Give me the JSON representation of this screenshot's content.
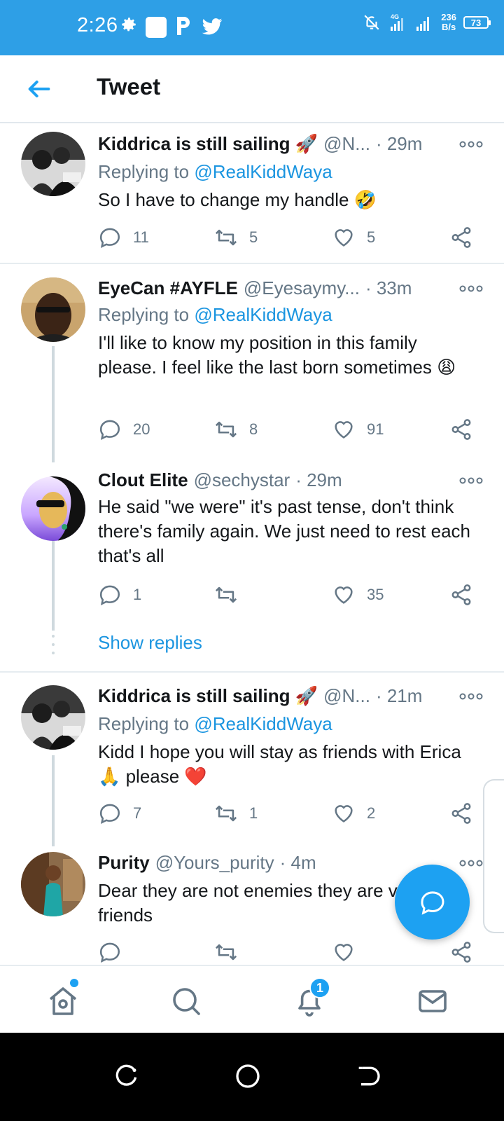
{
  "status_bar": {
    "time": "2:26",
    "net_speed_value": "236",
    "net_speed_unit": "B/s",
    "battery": "73",
    "network": "4G"
  },
  "header": {
    "title": "Tweet"
  },
  "tweets": [
    {
      "name": "Kiddrica is still sailing 🚀",
      "handle": "@N...",
      "time": "· 29m",
      "reply_prefix": "Replying to",
      "reply_to": "@RealKiddWaya",
      "text": "So I have to change my handle 🤣",
      "replies": "11",
      "retweets": "5",
      "likes": "5"
    },
    {
      "name": "EyeCan #AYFLE",
      "handle": "@Eyesaymy...",
      "time": "· 33m",
      "reply_prefix": "Replying to",
      "reply_to": "@RealKiddWaya",
      "text": "I'll like to know my position in this family please. I feel like the last born sometimes 😩",
      "replies": "20",
      "retweets": "8",
      "likes": "91"
    },
    {
      "name": "Clout Elite",
      "handle": "@sechystar",
      "time": "· 29m",
      "text": "He said \"we were\" it's past tense, don't think there's family again. We just need to rest each that's all",
      "replies": "1",
      "retweets": "",
      "likes": "35"
    },
    {
      "name": "Kiddrica is still sailing 🚀",
      "handle": "@N...",
      "time": "· 21m",
      "reply_prefix": "Replying to",
      "reply_to": "@RealKiddWaya",
      "text": "Kidd I hope you will stay as friends with Erica 🙏 please ❤️",
      "replies": "7",
      "retweets": "1",
      "likes": "2"
    },
    {
      "name": "Purity",
      "handle": "@Yours_purity",
      "time": "· 4m",
      "text": "Dear they are not enemies they are very friends",
      "replies": "",
      "retweets": "",
      "likes": ""
    }
  ],
  "show_replies": "Show replies",
  "bottom_nav": {
    "notification_badge": "1"
  },
  "colors": {
    "status_bar": "#2e9fe6",
    "accent": "#1da1f2",
    "link": "#1b95e0",
    "secondary_text": "#657786"
  }
}
